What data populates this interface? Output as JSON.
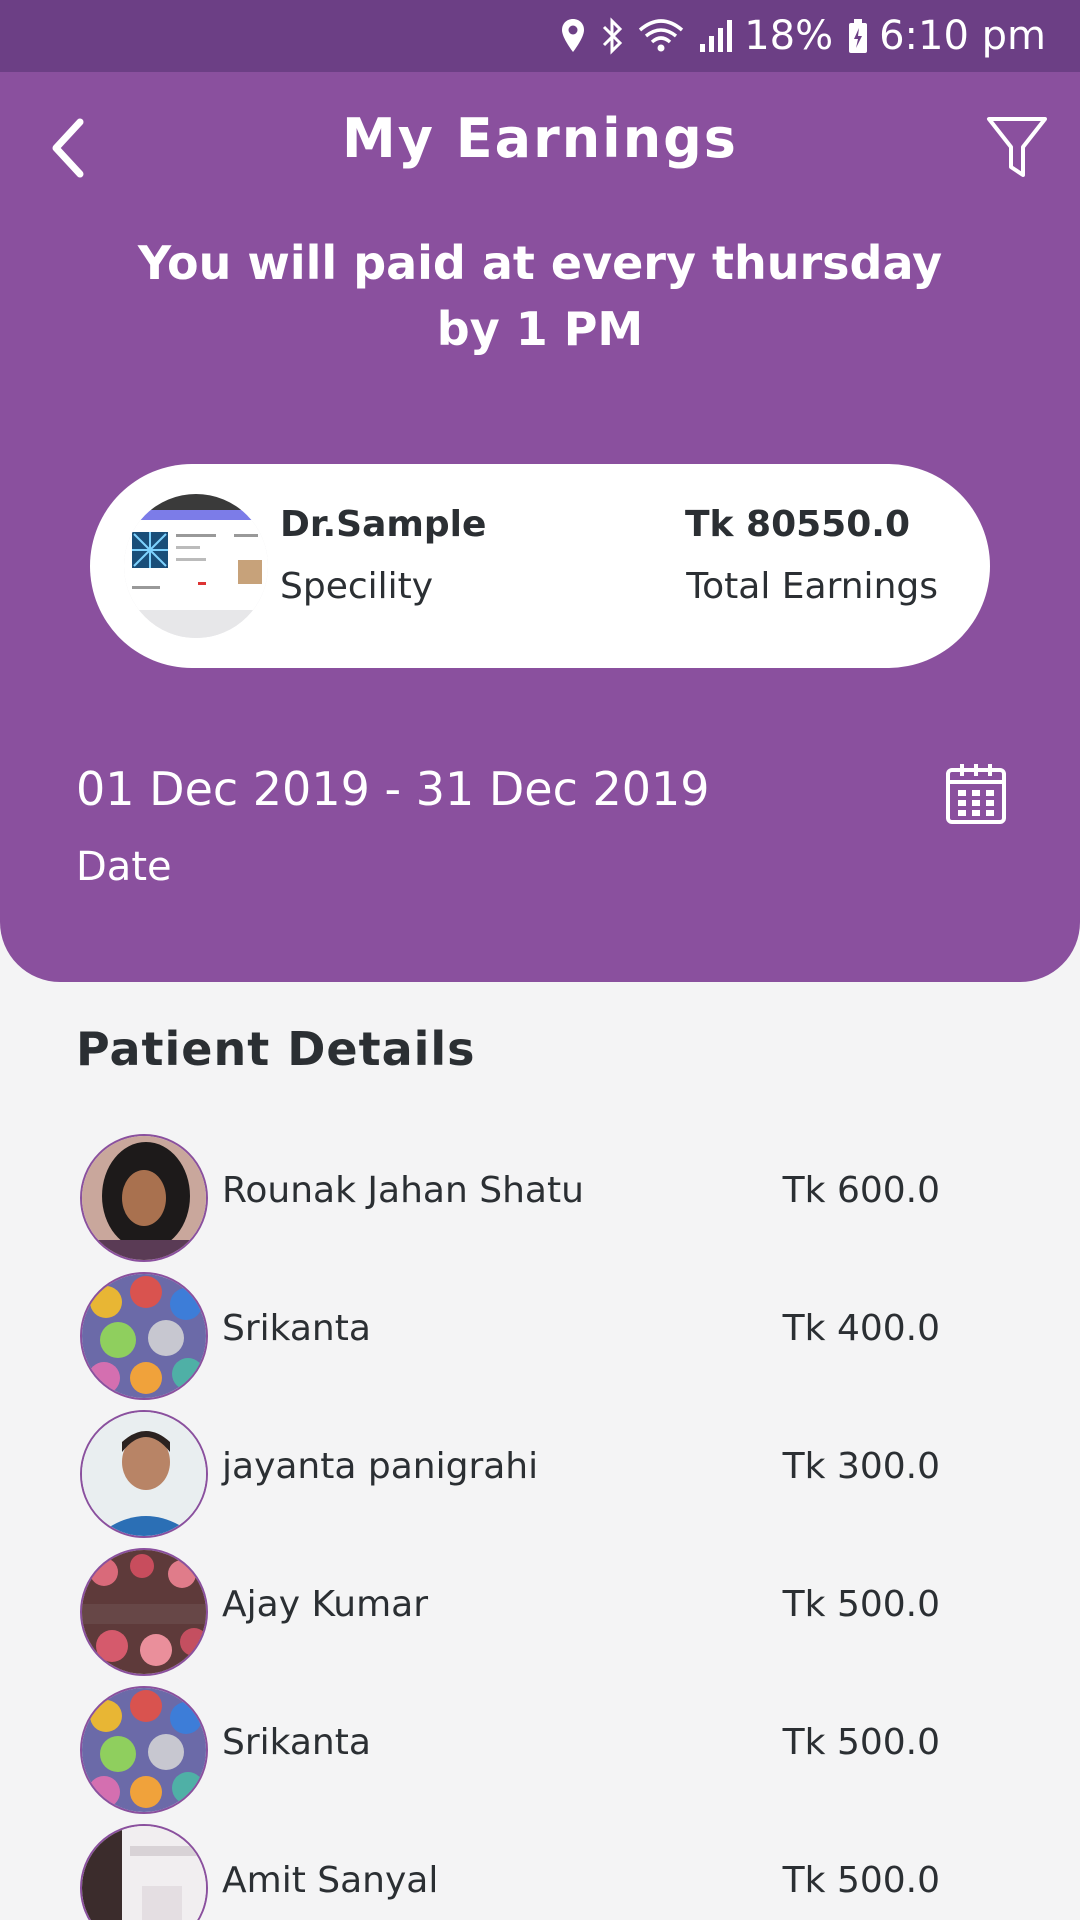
{
  "status": {
    "battery": "18%",
    "time": "6:10 pm",
    "icons": [
      "location-icon",
      "bluetooth-icon",
      "wifi-icon",
      "signal-icon",
      "battery-icon"
    ]
  },
  "header": {
    "title": "My Earnings",
    "notice": "You will paid at every thursday by 1 PM"
  },
  "doctor": {
    "name": "Dr.Sample",
    "speciality": "Specility",
    "total_amount": "Tk 80550.0",
    "total_label": "Total Earnings"
  },
  "date": {
    "range": "01 Dec 2019 - 31 Dec 2019",
    "label": "Date"
  },
  "patients": {
    "title": "Patient Details",
    "items": [
      {
        "name": "Rounak Jahan Shatu",
        "amount": "Tk 600.0"
      },
      {
        "name": "Srikanta",
        "amount": "Tk 400.0"
      },
      {
        "name": "jayanta panigrahi",
        "amount": "Tk 300.0"
      },
      {
        "name": "Ajay Kumar",
        "amount": "Tk 500.0"
      },
      {
        "name": "Srikanta",
        "amount": "Tk 500.0"
      },
      {
        "name": "Amit Sanyal",
        "amount": "Tk 500.0"
      }
    ]
  },
  "colors": {
    "primary": "#8a509e",
    "status_bar": "#6c3f85",
    "background": "#f4f4f5",
    "text": "#2b2f33"
  }
}
